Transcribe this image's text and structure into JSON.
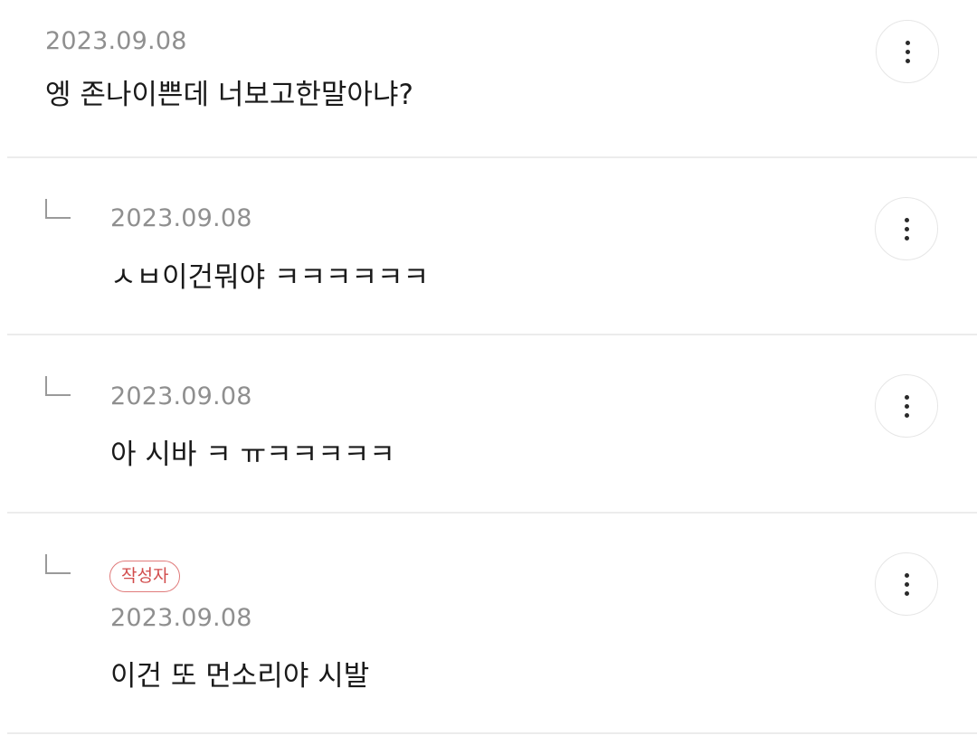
{
  "comments": [
    {
      "date": "2023.09.08",
      "text": "엥 존나이쁜데 너보고한말아냐?",
      "is_reply": false,
      "author_badge": ""
    },
    {
      "date": "2023.09.08",
      "text": "ㅅㅂ이건뭐야 ㅋㅋㅋㅋㅋㅋ",
      "is_reply": true,
      "author_badge": ""
    },
    {
      "date": "2023.09.08",
      "text": "아 시바 ㅋ ㅠㅋㅋㅋㅋㅋ",
      "is_reply": true,
      "author_badge": ""
    },
    {
      "date": "2023.09.08",
      "text": "이건 또 먼소리야 시발",
      "is_reply": true,
      "author_badge": "작성자"
    }
  ],
  "icons": {
    "more": "more-vertical-icon",
    "reply": "reply-arrow-icon"
  },
  "colors": {
    "date_text": "#8f8f8f",
    "body_text": "#1a1a1a",
    "divider": "#ececec",
    "author_badge": "#d24c4c"
  }
}
